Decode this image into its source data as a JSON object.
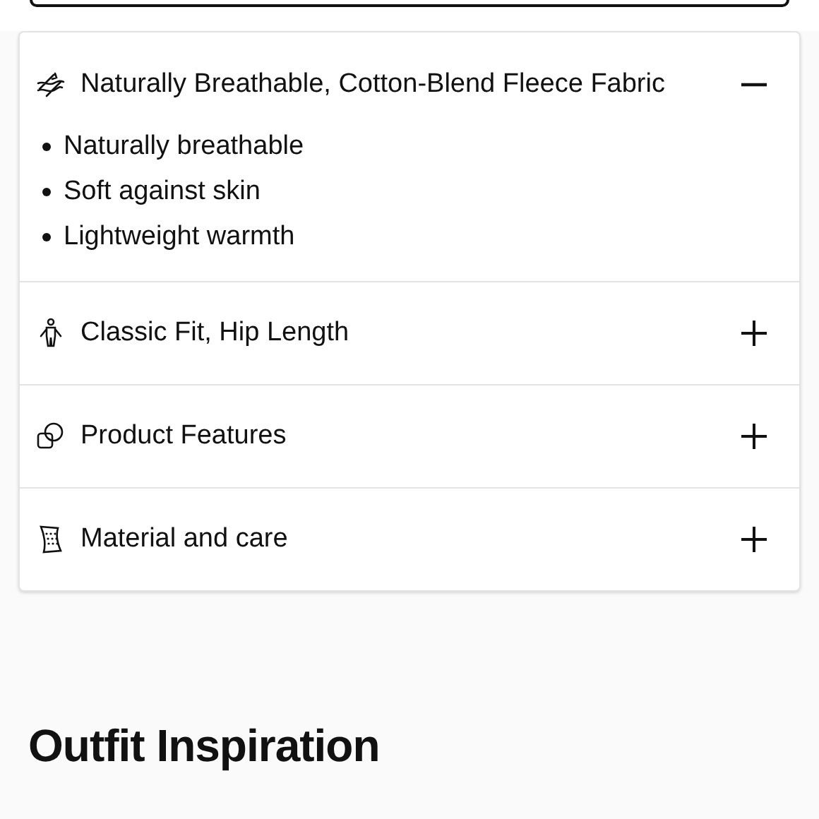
{
  "accordion": [
    {
      "title": "Naturally Breathable, Cotton-Blend Fleece Fabric",
      "expanded": true,
      "bullets": [
        "Naturally breathable",
        "Soft against skin",
        "Lightweight warmth"
      ]
    },
    {
      "title": "Classic Fit, Hip Length",
      "expanded": false
    },
    {
      "title": "Product Features",
      "expanded": false
    },
    {
      "title": "Material and care",
      "expanded": false
    }
  ],
  "section_heading": "Outfit Inspiration"
}
